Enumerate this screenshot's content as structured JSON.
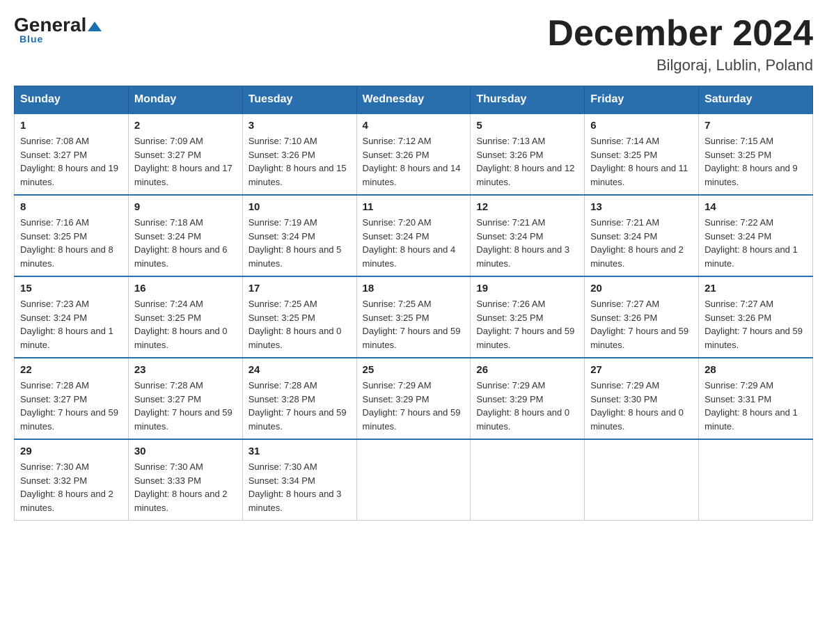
{
  "header": {
    "logo": {
      "general": "General",
      "blue": "Blue",
      "underline": "Blue"
    },
    "title": "December 2024",
    "location": "Bilgoraj, Lublin, Poland"
  },
  "days_of_week": [
    "Sunday",
    "Monday",
    "Tuesday",
    "Wednesday",
    "Thursday",
    "Friday",
    "Saturday"
  ],
  "weeks": [
    [
      {
        "day": 1,
        "sunrise": "7:08 AM",
        "sunset": "3:27 PM",
        "daylight": "8 hours and 19 minutes."
      },
      {
        "day": 2,
        "sunrise": "7:09 AM",
        "sunset": "3:27 PM",
        "daylight": "8 hours and 17 minutes."
      },
      {
        "day": 3,
        "sunrise": "7:10 AM",
        "sunset": "3:26 PM",
        "daylight": "8 hours and 15 minutes."
      },
      {
        "day": 4,
        "sunrise": "7:12 AM",
        "sunset": "3:26 PM",
        "daylight": "8 hours and 14 minutes."
      },
      {
        "day": 5,
        "sunrise": "7:13 AM",
        "sunset": "3:26 PM",
        "daylight": "8 hours and 12 minutes."
      },
      {
        "day": 6,
        "sunrise": "7:14 AM",
        "sunset": "3:25 PM",
        "daylight": "8 hours and 11 minutes."
      },
      {
        "day": 7,
        "sunrise": "7:15 AM",
        "sunset": "3:25 PM",
        "daylight": "8 hours and 9 minutes."
      }
    ],
    [
      {
        "day": 8,
        "sunrise": "7:16 AM",
        "sunset": "3:25 PM",
        "daylight": "8 hours and 8 minutes."
      },
      {
        "day": 9,
        "sunrise": "7:18 AM",
        "sunset": "3:24 PM",
        "daylight": "8 hours and 6 minutes."
      },
      {
        "day": 10,
        "sunrise": "7:19 AM",
        "sunset": "3:24 PM",
        "daylight": "8 hours and 5 minutes."
      },
      {
        "day": 11,
        "sunrise": "7:20 AM",
        "sunset": "3:24 PM",
        "daylight": "8 hours and 4 minutes."
      },
      {
        "day": 12,
        "sunrise": "7:21 AM",
        "sunset": "3:24 PM",
        "daylight": "8 hours and 3 minutes."
      },
      {
        "day": 13,
        "sunrise": "7:21 AM",
        "sunset": "3:24 PM",
        "daylight": "8 hours and 2 minutes."
      },
      {
        "day": 14,
        "sunrise": "7:22 AM",
        "sunset": "3:24 PM",
        "daylight": "8 hours and 1 minute."
      }
    ],
    [
      {
        "day": 15,
        "sunrise": "7:23 AM",
        "sunset": "3:24 PM",
        "daylight": "8 hours and 1 minute."
      },
      {
        "day": 16,
        "sunrise": "7:24 AM",
        "sunset": "3:25 PM",
        "daylight": "8 hours and 0 minutes."
      },
      {
        "day": 17,
        "sunrise": "7:25 AM",
        "sunset": "3:25 PM",
        "daylight": "8 hours and 0 minutes."
      },
      {
        "day": 18,
        "sunrise": "7:25 AM",
        "sunset": "3:25 PM",
        "daylight": "7 hours and 59 minutes."
      },
      {
        "day": 19,
        "sunrise": "7:26 AM",
        "sunset": "3:25 PM",
        "daylight": "7 hours and 59 minutes."
      },
      {
        "day": 20,
        "sunrise": "7:27 AM",
        "sunset": "3:26 PM",
        "daylight": "7 hours and 59 minutes."
      },
      {
        "day": 21,
        "sunrise": "7:27 AM",
        "sunset": "3:26 PM",
        "daylight": "7 hours and 59 minutes."
      }
    ],
    [
      {
        "day": 22,
        "sunrise": "7:28 AM",
        "sunset": "3:27 PM",
        "daylight": "7 hours and 59 minutes."
      },
      {
        "day": 23,
        "sunrise": "7:28 AM",
        "sunset": "3:27 PM",
        "daylight": "7 hours and 59 minutes."
      },
      {
        "day": 24,
        "sunrise": "7:28 AM",
        "sunset": "3:28 PM",
        "daylight": "7 hours and 59 minutes."
      },
      {
        "day": 25,
        "sunrise": "7:29 AM",
        "sunset": "3:29 PM",
        "daylight": "7 hours and 59 minutes."
      },
      {
        "day": 26,
        "sunrise": "7:29 AM",
        "sunset": "3:29 PM",
        "daylight": "8 hours and 0 minutes."
      },
      {
        "day": 27,
        "sunrise": "7:29 AM",
        "sunset": "3:30 PM",
        "daylight": "8 hours and 0 minutes."
      },
      {
        "day": 28,
        "sunrise": "7:29 AM",
        "sunset": "3:31 PM",
        "daylight": "8 hours and 1 minute."
      }
    ],
    [
      {
        "day": 29,
        "sunrise": "7:30 AM",
        "sunset": "3:32 PM",
        "daylight": "8 hours and 2 minutes."
      },
      {
        "day": 30,
        "sunrise": "7:30 AM",
        "sunset": "3:33 PM",
        "daylight": "8 hours and 2 minutes."
      },
      {
        "day": 31,
        "sunrise": "7:30 AM",
        "sunset": "3:34 PM",
        "daylight": "8 hours and 3 minutes."
      },
      null,
      null,
      null,
      null
    ]
  ]
}
